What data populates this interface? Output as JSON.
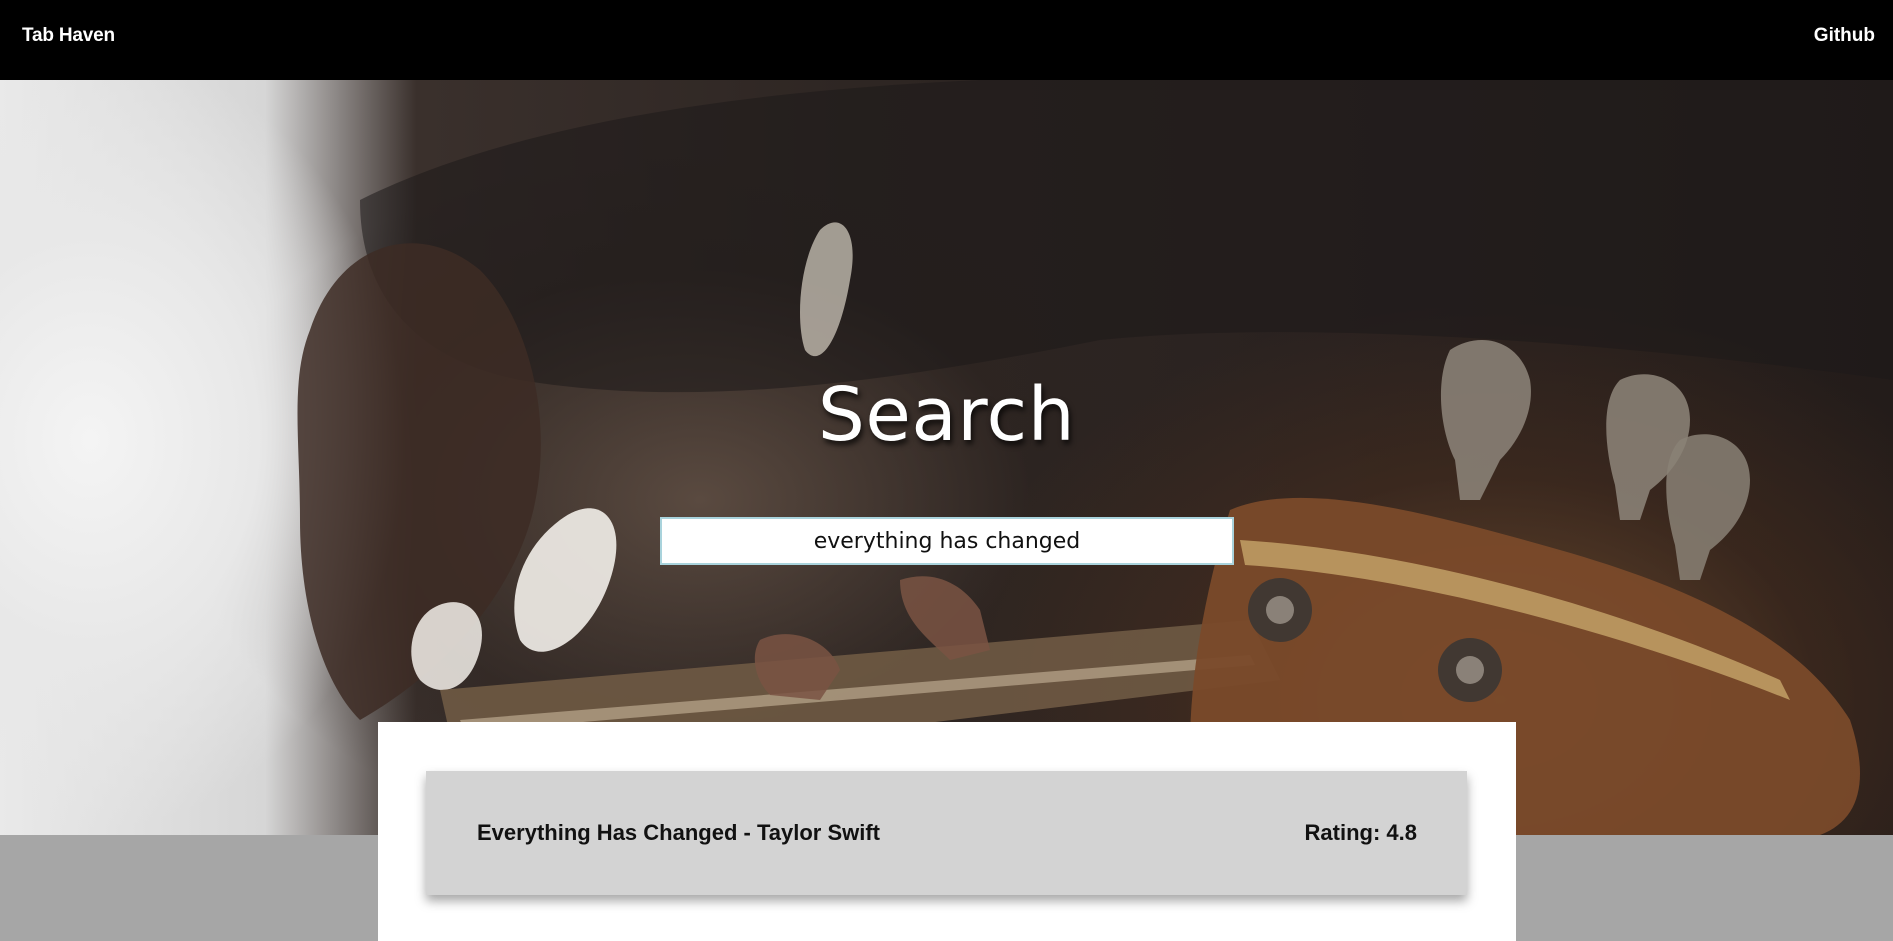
{
  "navbar": {
    "brand": "Tab Haven",
    "github_label": "Github"
  },
  "hero": {
    "title": "Search",
    "background_icon": "guitar-photo"
  },
  "search": {
    "value": "everything has changed",
    "placeholder": ""
  },
  "results": [
    {
      "title": "Everything Has Changed - Taylor Swift",
      "rating_label": "Rating: 4.8"
    }
  ],
  "colors": {
    "navbar_bg": "#000000",
    "card_bg": "#d3d3d3",
    "panel_bg": "#ffffff",
    "page_bg": "#a6a6a6",
    "input_border": "#a9d3dc"
  }
}
